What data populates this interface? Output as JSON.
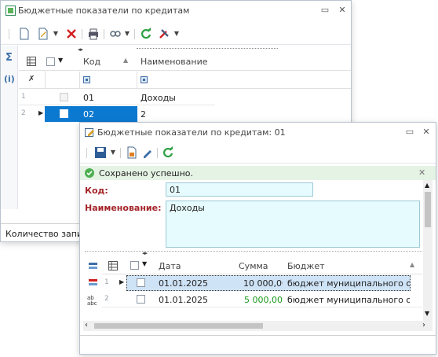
{
  "window1": {
    "title": "Бюджетные показатели по кредитам",
    "grid": {
      "col_code": "Код",
      "col_name": "Наименование",
      "rows": [
        {
          "num": "1",
          "code": "01",
          "name": "Доходы"
        },
        {
          "num": "2",
          "code": "02",
          "name": "2"
        }
      ]
    },
    "status_text": "Количество запис"
  },
  "window2": {
    "title": "Бюджетные показатели по кредитам: 01",
    "success_message": "Сохранено успешно.",
    "form": {
      "code_label": "Код:",
      "code_value": "01",
      "name_label": "Наименование:",
      "name_value": "Доходы"
    },
    "grid": {
      "col_date": "Дата",
      "col_sum": "Сумма",
      "col_budget": "Бюджет",
      "rows": [
        {
          "num": "1",
          "date": "01.01.2025",
          "sum": "10 000,00",
          "budget": "бюджет муниципального о..."
        },
        {
          "num": "2",
          "date": "01.01.2025",
          "sum": "5 000,00",
          "budget": "бюджет муниципального о..."
        }
      ]
    },
    "sigma_side": "Σ",
    "info_side": "(i)"
  },
  "colors": {
    "selected_row": "#0b79d0",
    "success_bg": "#e5f3e5",
    "sum_green": "#1a9a1a",
    "label_red": "#a4262c",
    "field_bg": "#e6fbfd"
  }
}
